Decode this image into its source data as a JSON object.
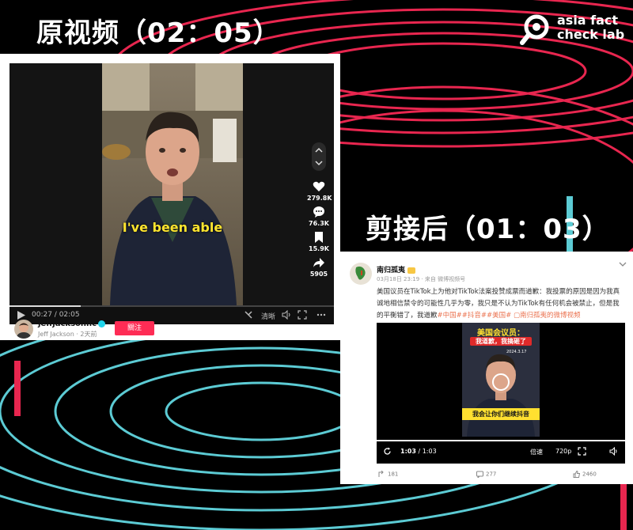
{
  "labels": {
    "original": "原视频（02：05）",
    "edited": "剪接后（01：03）"
  },
  "logo": {
    "line1": "asia fact",
    "line2": "check lab"
  },
  "colors": {
    "background": "#000000",
    "ring_red": "#e8264f",
    "ring_cyan": "#5ccbd4",
    "tiktok_follow": "#fe2c55",
    "weibo_tag": "#eb7350",
    "caption_yellow": "#ffe52e"
  },
  "tiktok": {
    "caption": "I've been able",
    "likes": "279.8K",
    "comments": "76.3K",
    "saves": "15.9K",
    "shares": "5905",
    "time": "00:27 / 02:05",
    "progress": 0.22,
    "quality": "清晰",
    "author_handle": "jeffjacksonnc",
    "author_sub": "Jeff Jackson · 2天前",
    "follow_label": "關注",
    "icons": [
      "heart-icon",
      "comment-icon",
      "bookmark-icon",
      "share-icon",
      "play-icon",
      "volume-icon",
      "fullscreen-icon",
      "more-icon"
    ]
  },
  "weibo": {
    "name": "南归孤夷",
    "meta": "03月18日 23:19 · 来自 微博视频号",
    "text_main": "美国议员在TikTok上为他对TikTok法案投赞成票而道歉：我投票的原因是因为我真诚地相信禁令的可能性几乎为零，我只是不认为TikTok有任何机会被禁止，但是我的平衡错了，我道歉",
    "tags": "#中国##抖音##美国# ▢南归孤夷的微博视频",
    "clip_title1": "美国会议员：",
    "clip_title2": "我道歉，我搞砸了",
    "clip_date": "2024.3.17",
    "clip_subtitle": "我会让你们继续抖音",
    "time_current": "1:03",
    "time_total": "/ 1:03",
    "quality": "倍速",
    "resolution": "720p",
    "reposts": "181",
    "comments": "277",
    "likes": "2460"
  }
}
